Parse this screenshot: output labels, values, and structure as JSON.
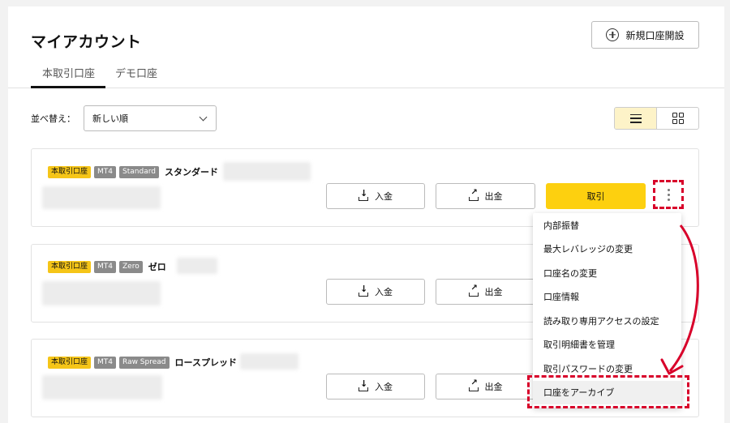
{
  "header": {
    "title": "マイアカウント",
    "new_account_label": "新規口座開設"
  },
  "tabs": [
    {
      "label": "本取引口座",
      "active": true
    },
    {
      "label": "デモ口座",
      "active": false
    }
  ],
  "sort": {
    "label": "並べ替え：",
    "selected": "新しい順"
  },
  "view_toggle": {
    "active": "list"
  },
  "accounts": [
    {
      "type_badge": "本取引口座",
      "platform": "MT4",
      "plan": "Standard",
      "name": "スタンダード"
    },
    {
      "type_badge": "本取引口座",
      "platform": "MT4",
      "plan": "Zero",
      "name": "ゼロ"
    },
    {
      "type_badge": "本取引口座",
      "platform": "MT4",
      "plan": "Raw Spread",
      "name": "ロースプレッド"
    }
  ],
  "buttons": {
    "deposit": "入金",
    "withdraw": "出金",
    "trade": "取引"
  },
  "menu": {
    "items": [
      "内部振替",
      "最大レバレッジの変更",
      "口座名の変更",
      "口座情報",
      "読み取り専用アクセスの設定",
      "取引明細書を管理",
      "取引パスワードの変更",
      "口座をアーカイブ"
    ],
    "highlighted_index": 7
  },
  "colors": {
    "accent": "#fdd00f",
    "badge_yellow": "#f5c518",
    "badge_grey": "#8a8a8a",
    "annotation_red": "#d8002a"
  },
  "icons": {
    "deposit": "download-icon",
    "withdraw": "upload-icon",
    "more": "kebab-menu-icon",
    "new": "plus-circle-icon"
  }
}
